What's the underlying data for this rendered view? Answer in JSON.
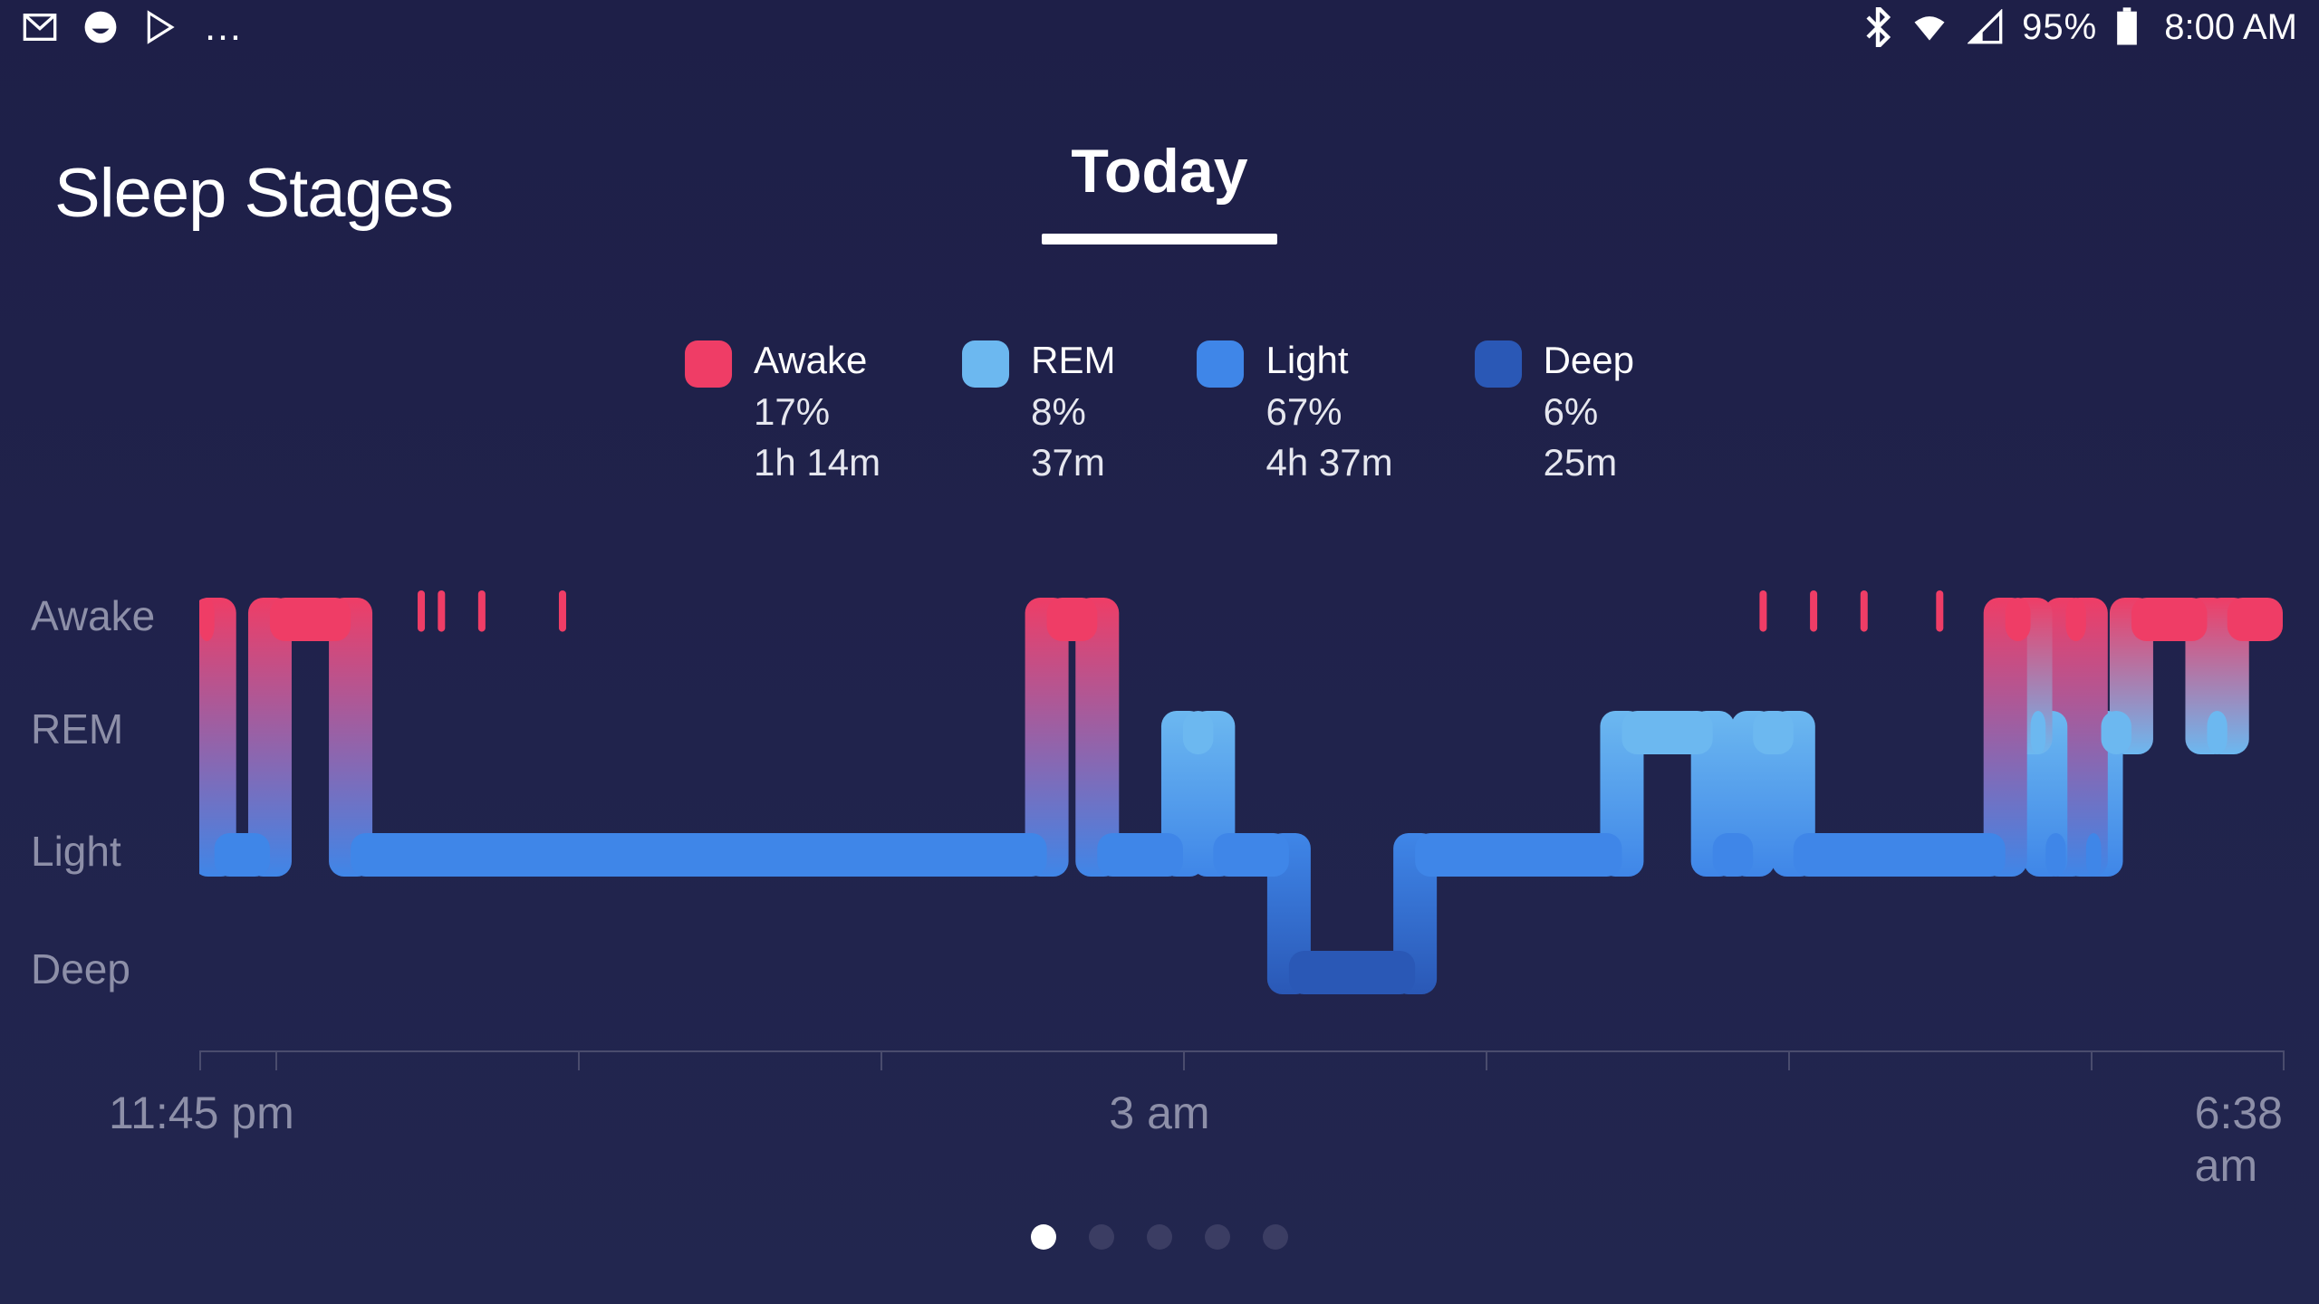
{
  "status": {
    "battery_pct": "95%",
    "clock": "8:00 AM"
  },
  "header": {
    "title": "Sleep Stages",
    "date_label": "Today"
  },
  "legend": [
    {
      "name": "Awake",
      "pct": "17%",
      "dur": "1h 14m",
      "color": "#ef3d66"
    },
    {
      "name": "REM",
      "pct": "8%",
      "dur": "37m",
      "color": "#6cb8f0"
    },
    {
      "name": "Light",
      "pct": "67%",
      "dur": "4h 37m",
      "color": "#3f86e8"
    },
    {
      "name": "Deep",
      "pct": "6%",
      "dur": "25m",
      "color": "#2a58b6"
    }
  ],
  "colors": {
    "awake": "#ef3d66",
    "rem": "#6cb8f0",
    "light": "#3f86e8",
    "deep": "#2a58b6"
  },
  "pager": {
    "count": 5,
    "active": 0
  },
  "chart_data": {
    "type": "step",
    "title": "Sleep Stages",
    "y_categories": [
      "Awake",
      "REM",
      "Light",
      "Deep"
    ],
    "x_start_label": "11:45 pm",
    "x_mid_label": "3 am",
    "x_end_label": "6:38 am",
    "x_start_min": 0,
    "x_end_min": 413,
    "x_ticks_min": [
      0,
      15,
      75,
      135,
      195,
      255,
      315,
      375,
      413
    ],
    "segments": [
      {
        "start": 0,
        "end": 3,
        "stage": "Awake"
      },
      {
        "start": 3,
        "end": 14,
        "stage": "Light"
      },
      {
        "start": 14,
        "end": 30,
        "stage": "Awake"
      },
      {
        "start": 30,
        "end": 168,
        "stage": "Light"
      },
      {
        "start": 168,
        "end": 178,
        "stage": "Awake"
      },
      {
        "start": 178,
        "end": 195,
        "stage": "Light"
      },
      {
        "start": 195,
        "end": 201,
        "stage": "REM"
      },
      {
        "start": 201,
        "end": 216,
        "stage": "Light"
      },
      {
        "start": 216,
        "end": 241,
        "stage": "Deep"
      },
      {
        "start": 241,
        "end": 282,
        "stage": "Light"
      },
      {
        "start": 282,
        "end": 300,
        "stage": "REM"
      },
      {
        "start": 300,
        "end": 308,
        "stage": "Light"
      },
      {
        "start": 308,
        "end": 316,
        "stage": "REM"
      },
      {
        "start": 316,
        "end": 358,
        "stage": "Light"
      },
      {
        "start": 358,
        "end": 363,
        "stage": "Awake"
      },
      {
        "start": 363,
        "end": 366,
        "stage": "REM"
      },
      {
        "start": 366,
        "end": 370,
        "stage": "Light"
      },
      {
        "start": 370,
        "end": 374,
        "stage": "Awake"
      },
      {
        "start": 374,
        "end": 377,
        "stage": "Light"
      },
      {
        "start": 377,
        "end": 383,
        "stage": "REM"
      },
      {
        "start": 383,
        "end": 398,
        "stage": "Awake"
      },
      {
        "start": 398,
        "end": 402,
        "stage": "REM"
      },
      {
        "start": 402,
        "end": 413,
        "stage": "Awake"
      }
    ],
    "brief_awake_min": [
      44,
      48,
      56,
      72,
      310,
      320,
      330,
      345
    ]
  }
}
